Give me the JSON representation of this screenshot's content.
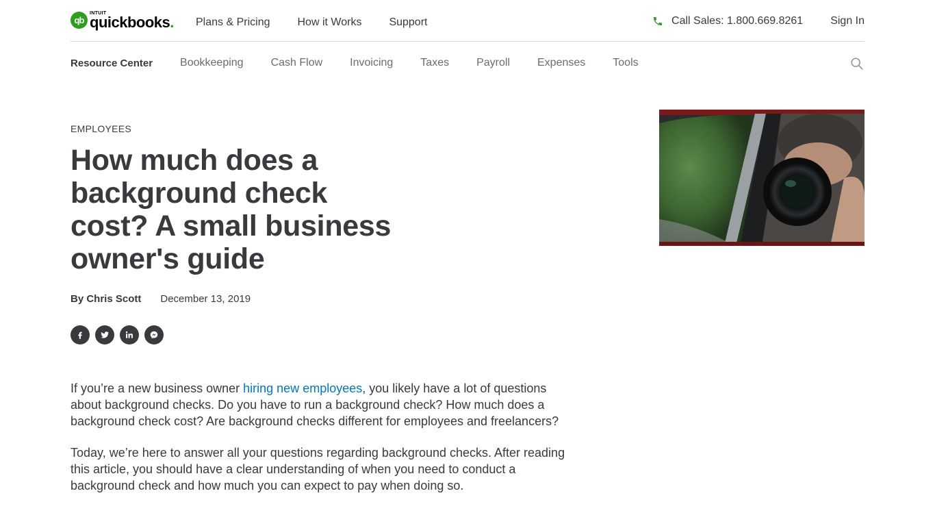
{
  "header": {
    "logo": {
      "badge": "qb",
      "brand_small": "INTUIT",
      "brand": "quickbooks",
      "brand_dot": "."
    },
    "nav": [
      {
        "label": "Plans & Pricing"
      },
      {
        "label": "How it Works"
      },
      {
        "label": "Support"
      }
    ],
    "call_sales": "Call Sales: 1.800.669.8261",
    "sign_in": "Sign In"
  },
  "subnav": {
    "items": [
      {
        "label": "Resource Center",
        "active": true
      },
      {
        "label": "Bookkeeping"
      },
      {
        "label": "Cash Flow"
      },
      {
        "label": "Invoicing"
      },
      {
        "label": "Taxes"
      },
      {
        "label": "Payroll"
      },
      {
        "label": "Expenses"
      },
      {
        "label": "Tools"
      }
    ]
  },
  "article": {
    "category": "EMPLOYEES",
    "title": "How much does a background check cost? A small business owner's guide",
    "author": "By Chris Scott",
    "date": "December 13, 2019",
    "share": [
      "facebook",
      "twitter",
      "linkedin",
      "messenger"
    ],
    "hero_image_alt": "Man photographing from car window with camera",
    "paragraphs": [
      {
        "before": "If you’re a new business owner ",
        "link": "hiring new employees",
        "after": ", you likely have a lot of questions about background checks. Do you have to run a background check? How much does a background check cost? Are background checks different for employees and freelancers?"
      },
      {
        "text": "Today, we’re here to answer all your questions regarding background checks. After reading this article, you should have a clear understanding of when you need to conduct a background check and how much you can expect to pay when doing so."
      }
    ]
  },
  "colors": {
    "brand_green": "#2ca01c",
    "text": "#393a3d",
    "link": "#0077c5",
    "muted": "#6b6c72"
  }
}
